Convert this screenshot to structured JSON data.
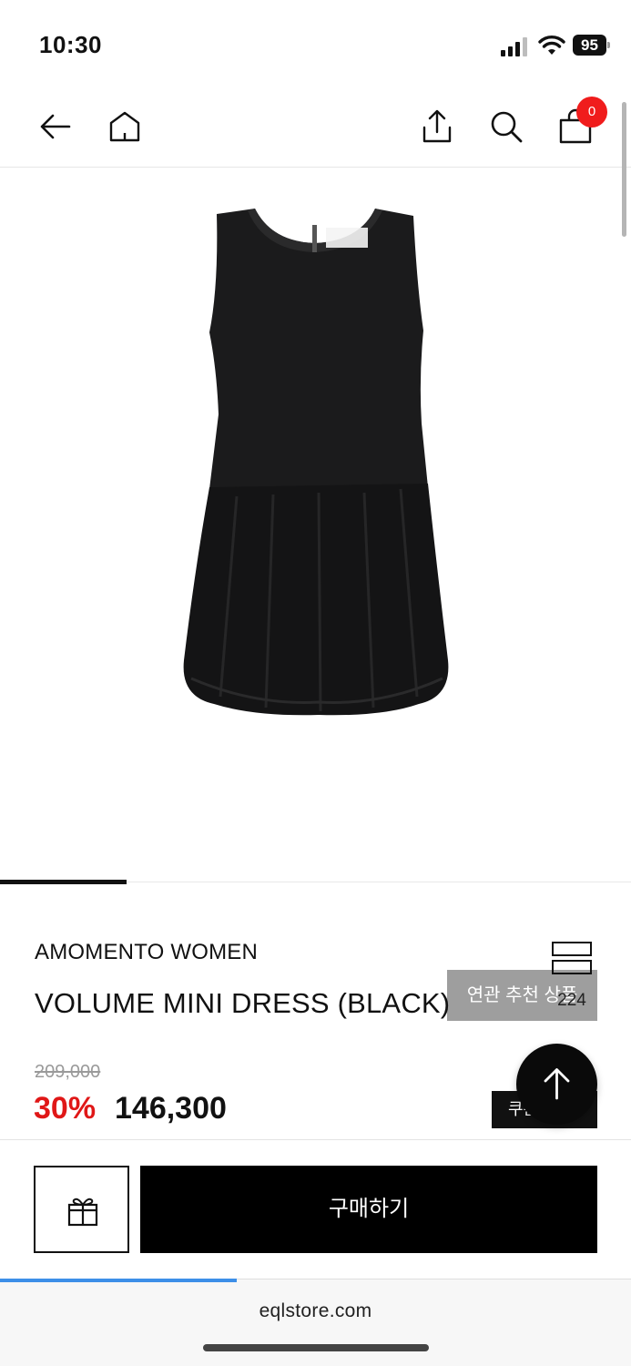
{
  "status_bar": {
    "time": "10:30",
    "battery": "95",
    "icons": [
      "signal-icon",
      "wifi-icon",
      "battery-icon"
    ]
  },
  "nav": {
    "icons": [
      "back-arrow-icon",
      "home-icon",
      "share-icon",
      "search-icon",
      "shopping-bag-icon"
    ],
    "cart_count": "0"
  },
  "product": {
    "image": "black-sleeveless-dress-image",
    "related_label": "연관 추천 상품",
    "brand": "AMOMENTO WOMEN",
    "name": "VOLUME MINI DRESS (BLACK)",
    "wish_count": "224",
    "original_price": "209,000",
    "discount": "30%",
    "price": "146,300",
    "coupon_label": "쿠폰"
  },
  "actions": {
    "gift_icon": "gift-icon",
    "buy_label": "구매하기"
  },
  "browser": {
    "url": "eqlstore.com",
    "load_progress": 0.375
  },
  "colors": {
    "discount": "#e01717",
    "badge": "#f01c1c",
    "progress": "#3d8fe8",
    "primary_button": "#000000",
    "related_button": "#9e9e9e"
  }
}
